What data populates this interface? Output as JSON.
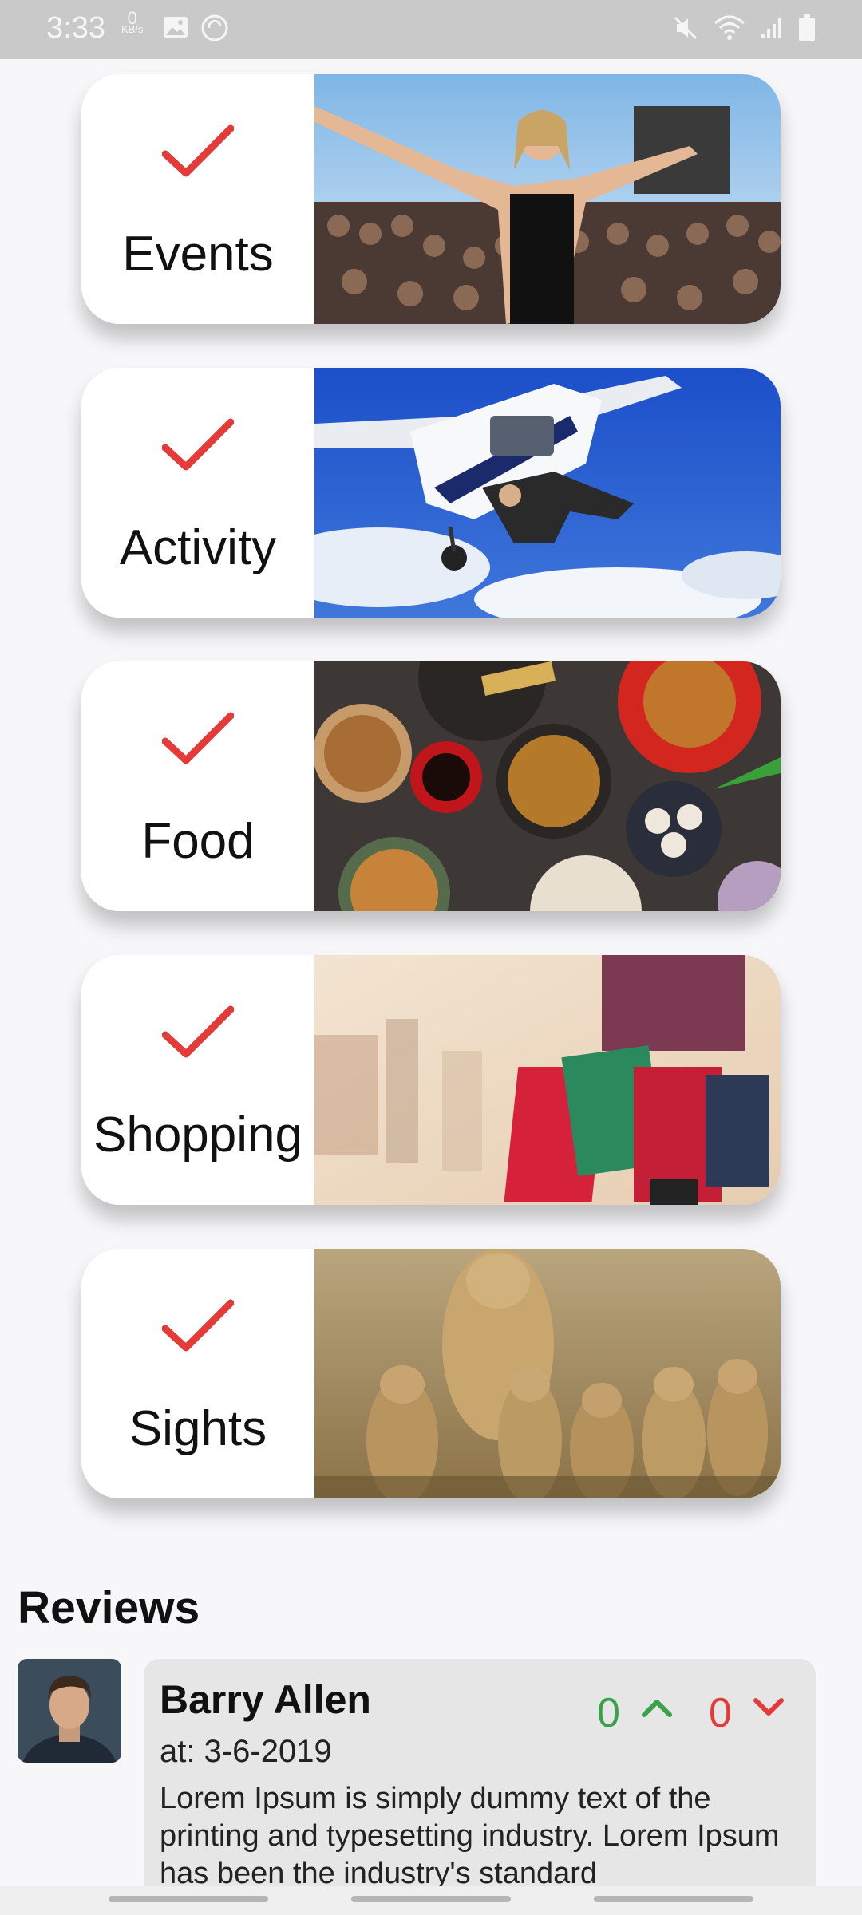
{
  "status_bar": {
    "time": "3:33",
    "speed_value": "0",
    "speed_unit": "KB/s"
  },
  "colors": {
    "accent_red": "#e53b38",
    "upvote_green": "#3aa349"
  },
  "categories": [
    {
      "label": "Events",
      "icon": "check-icon",
      "image": "concert-crowd-image"
    },
    {
      "label": "Activity",
      "icon": "check-icon",
      "image": "skydiving-plane-image"
    },
    {
      "label": "Food",
      "icon": "check-icon",
      "image": "asian-food-spread-image"
    },
    {
      "label": "Shopping",
      "icon": "check-icon",
      "image": "shopping-bags-image"
    },
    {
      "label": "Sights",
      "icon": "check-icon",
      "image": "cheetah-family-image"
    }
  ],
  "reviews": {
    "title": "Reviews",
    "items": [
      {
        "name": "Barry Allen",
        "date": "at: 3-6-2019",
        "upvotes": "0",
        "downvotes": "0",
        "text": "Lorem Ipsum is simply dummy text of the printing and typesetting industry. Lorem Ipsum has been the industry's standard"
      }
    ]
  }
}
